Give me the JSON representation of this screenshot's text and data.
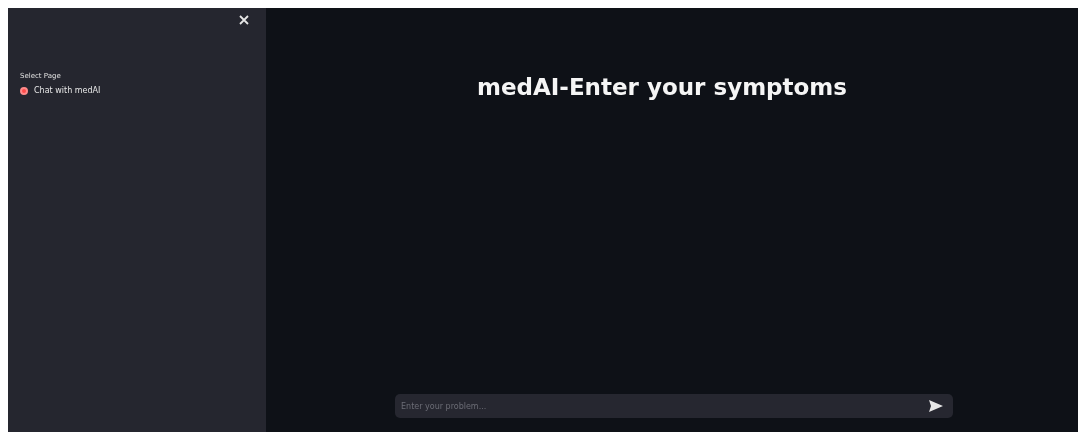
{
  "sidebar": {
    "label": "Select Page",
    "options": [
      {
        "label": "Chat with medAI",
        "selected": true
      }
    ]
  },
  "title": "medAI-Enter your symptoms",
  "chat_input": {
    "placeholder": "Enter your problem..."
  }
}
